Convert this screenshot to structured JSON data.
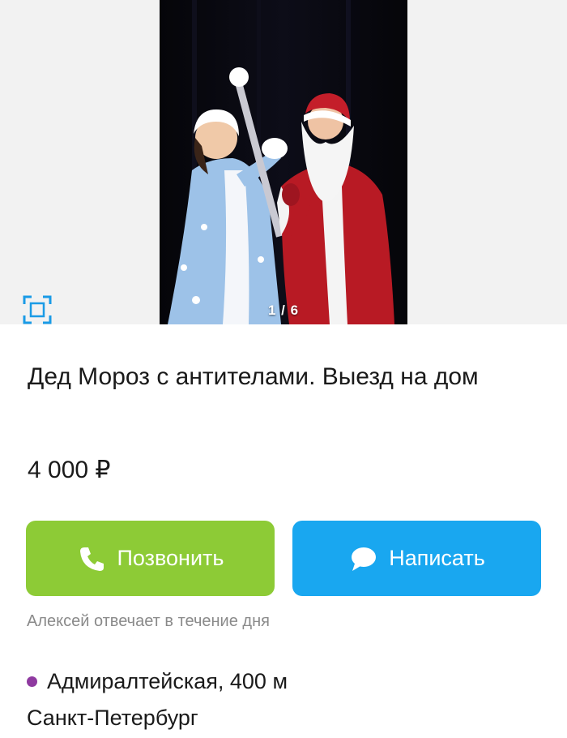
{
  "gallery": {
    "counter": "1 / 6",
    "expand_icon": "fullscreen-icon"
  },
  "listing": {
    "title": "Дед Мороз с антителами. Выезд на дом",
    "price": "4 000 ₽"
  },
  "actions": {
    "call_label": "Позвонить",
    "call_icon": "phone-icon",
    "call_color": "#8dcb36",
    "write_label": "Написать",
    "write_icon": "chat-bubble-icon",
    "write_color": "#19a7f0"
  },
  "seller": {
    "response_time": "Алексей отвечает в течение дня"
  },
  "location": {
    "metro": "Адмиралтейская, 400 м",
    "metro_color": "#8f3aa0",
    "city": "Санкт-Петербург"
  }
}
